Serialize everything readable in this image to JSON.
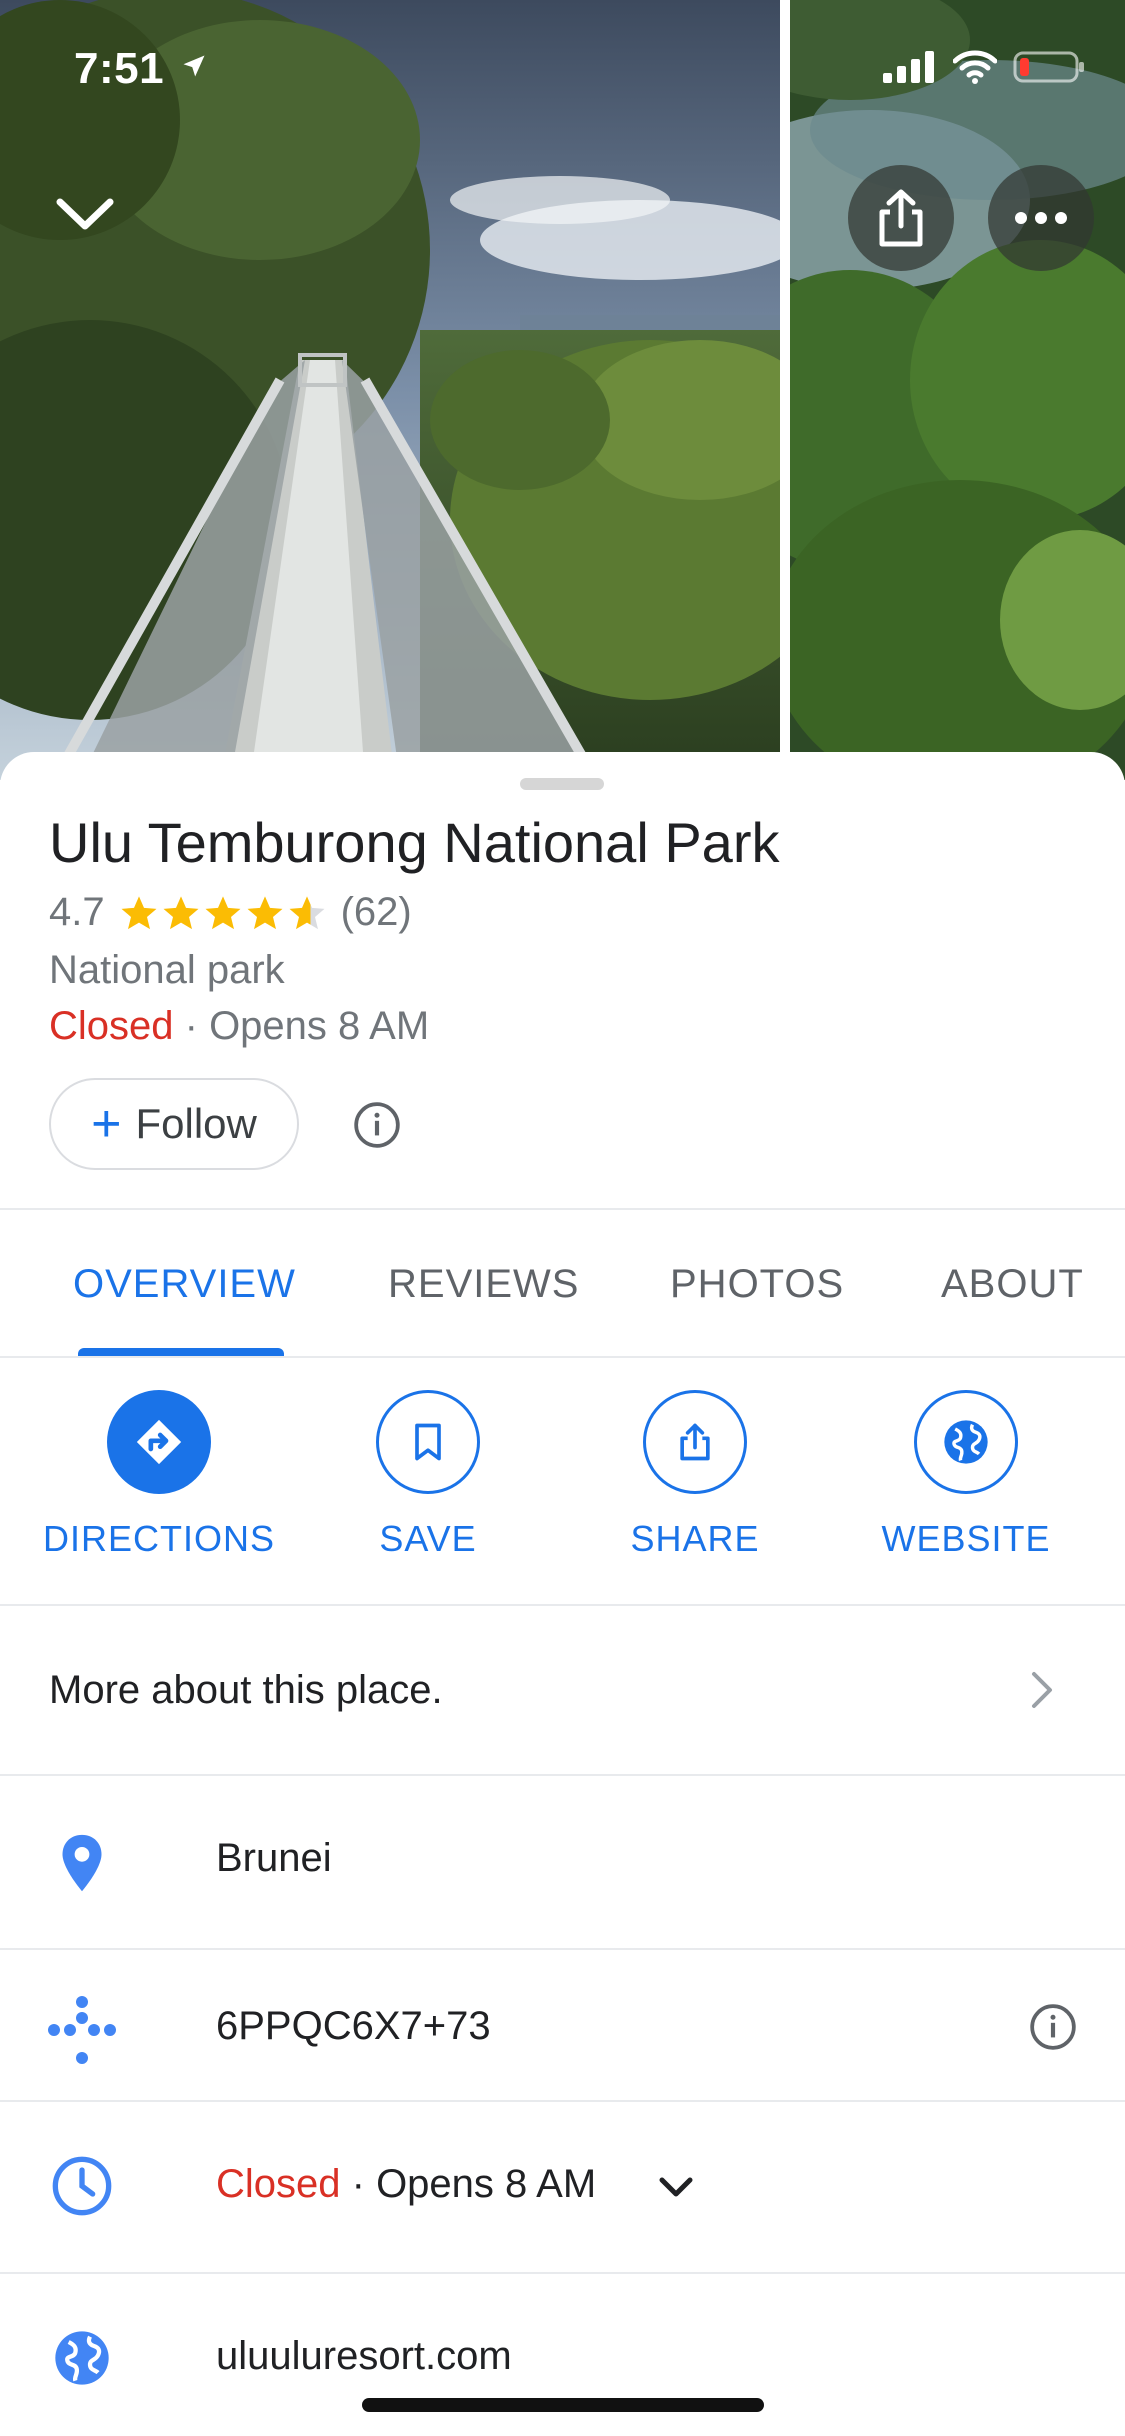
{
  "status_bar": {
    "time": "7:51"
  },
  "place": {
    "name": "Ulu Temburong National Park",
    "rating": "4.7",
    "rating_value": 4.7,
    "review_count": "(62)",
    "category": "National park",
    "status": "Closed",
    "hours_suffix": " · Opens 8 AM"
  },
  "follow": {
    "label": "Follow"
  },
  "tabs": [
    {
      "label": "OVERVIEW",
      "active": true
    },
    {
      "label": "REVIEWS"
    },
    {
      "label": "PHOTOS"
    },
    {
      "label": "ABOUT"
    }
  ],
  "actions": [
    {
      "label": "DIRECTIONS",
      "icon": "directions-icon"
    },
    {
      "label": "SAVE",
      "icon": "bookmark-icon"
    },
    {
      "label": "SHARE",
      "icon": "share-icon"
    },
    {
      "label": "WEBSITE",
      "icon": "globe-icon"
    }
  ],
  "more_about": "More about this place.",
  "details": {
    "address": "Brunei",
    "plus_code": "6PPQC6X7+73",
    "hours_status": "Closed",
    "hours_suffix": " · Opens 8 AM",
    "website": "uluuluresort.com"
  },
  "colors": {
    "accent": "#1a73e8",
    "closed": "#d93025",
    "star": "#fbbc04"
  }
}
